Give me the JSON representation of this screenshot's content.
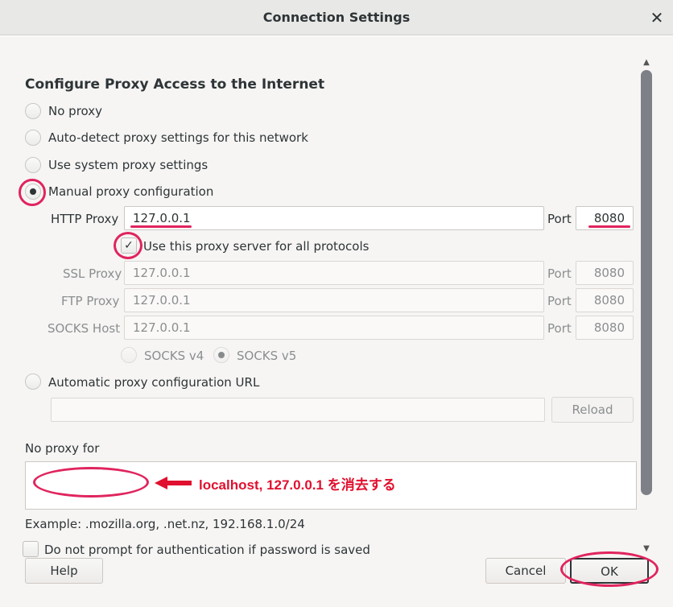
{
  "window": {
    "title": "Connection Settings",
    "close_glyph": "✕"
  },
  "section": {
    "heading": "Configure Proxy Access to the Internet"
  },
  "proxy_modes": [
    {
      "label": "No proxy",
      "checked": false
    },
    {
      "label": "Auto-detect proxy settings for this network",
      "checked": false
    },
    {
      "label": "Use system proxy settings",
      "checked": false
    },
    {
      "label": "Manual proxy configuration",
      "checked": true
    }
  ],
  "manual": {
    "http_label": "HTTP Proxy",
    "http_value": "127.0.0.1",
    "port_label": "Port",
    "http_port": "8080",
    "share_label": "Use this proxy server for all protocols",
    "share_checked": true,
    "share_check_glyph": "✓",
    "ssl_label": "SSL Proxy",
    "ssl_value": "127.0.0.1",
    "ssl_port": "8080",
    "ftp_label": "FTP Proxy",
    "ftp_value": "127.0.0.1",
    "ftp_port": "8080",
    "socks_label": "SOCKS Host",
    "socks_value": "127.0.0.1",
    "socks_port": "8080",
    "socks_v4_label": "SOCKS v4",
    "socks_v5_label": "SOCKS v5",
    "socks_version_selected": "SOCKS v5"
  },
  "auto_config": {
    "label": "Automatic proxy configuration URL",
    "url_value": "",
    "reload_label": "Reload"
  },
  "no_proxy": {
    "label": "No proxy for",
    "value": "",
    "example": "Example: .mozilla.org, .net.nz, 192.168.1.0/24"
  },
  "auth_prompt": {
    "label": "Do not prompt for authentication if password is saved",
    "checked": false
  },
  "buttons": {
    "help": "Help",
    "cancel": "Cancel",
    "ok": "OK"
  },
  "annotation": {
    "text": "localhost, 127.0.0.1 を消去する",
    "color": "#e0245e"
  },
  "scrollbar": {
    "up_glyph": "▲",
    "down_glyph": "▼"
  }
}
